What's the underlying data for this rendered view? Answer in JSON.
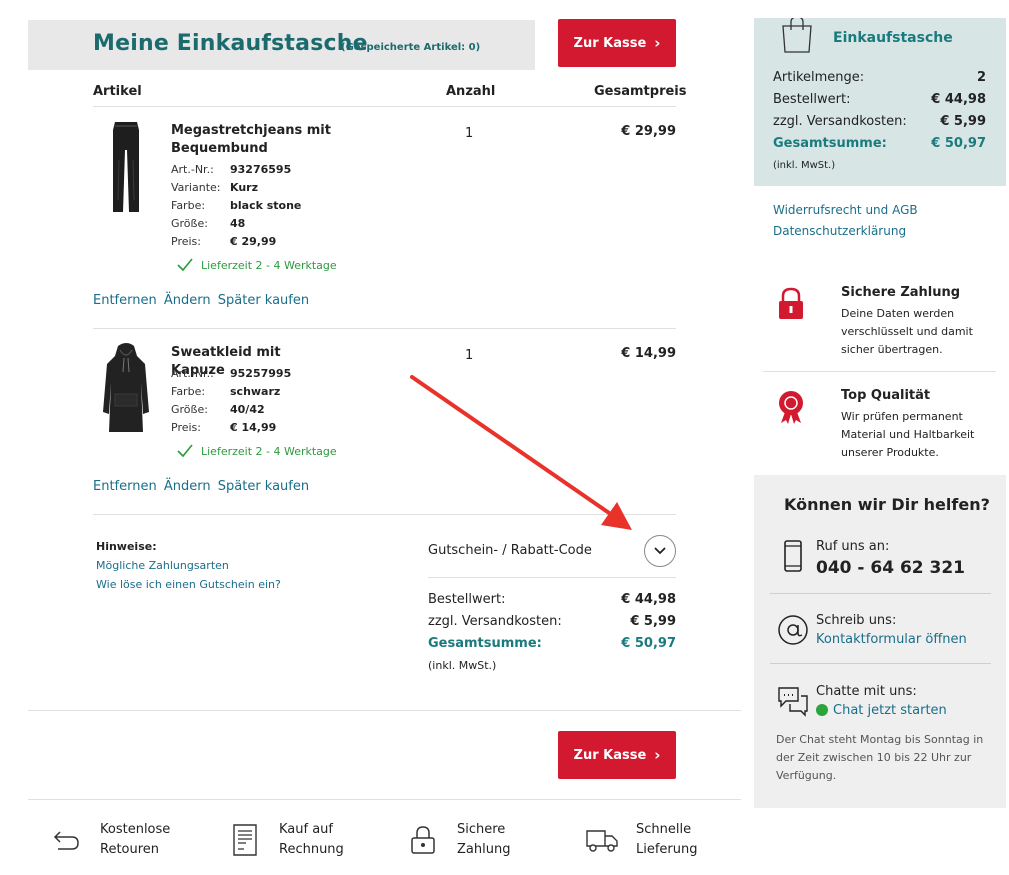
{
  "cart": {
    "title": "Meine Einkaufstasche",
    "saved_label": "(Gespeicherte Artikel: 0)",
    "checkout_label": "Zur Kasse",
    "columns": {
      "article": "Artikel",
      "quantity": "Anzahl",
      "total": "Gesamtpreis"
    }
  },
  "items": [
    {
      "name": "Megastretchjeans mit Bequembund",
      "quantity": "1",
      "price": "€ 29,99",
      "props": [
        {
          "k": "Art.-Nr.:",
          "v": "93276595"
        },
        {
          "k": "Variante:",
          "v": "Kurz"
        },
        {
          "k": "Farbe:",
          "v": "black stone"
        },
        {
          "k": "Größe:",
          "v": "48"
        },
        {
          "k": "Preis:",
          "v": "€ 29,99"
        }
      ],
      "delivery": "Lieferzeit 2 - 4 Werktage",
      "actions": {
        "remove": "Entfernen",
        "edit": "Ändern",
        "later": "Später kaufen"
      }
    },
    {
      "name": "Sweatkleid mit Kapuze",
      "quantity": "1",
      "price": "€ 14,99",
      "props": [
        {
          "k": "Art.-Nr.:",
          "v": "95257995"
        },
        {
          "k": "Farbe:",
          "v": "schwarz"
        },
        {
          "k": "Größe:",
          "v": "40/42"
        },
        {
          "k": "Preis:",
          "v": "€ 14,99"
        }
      ],
      "delivery": "Lieferzeit 2 - 4 Werktage",
      "actions": {
        "remove": "Entfernen",
        "edit": "Ändern",
        "later": "Später kaufen"
      }
    }
  ],
  "hints": {
    "heading": "Hinweise:",
    "payment_link": "Mögliche Zahlungsarten",
    "voucher_link": "Wie löse ich einen Gutschein ein?"
  },
  "coupon": {
    "label": "Gutschein- / Rabatt-Code"
  },
  "summary": {
    "order_value_label": "Bestellwert:",
    "order_value": "€ 44,98",
    "shipping_label": "zzgl. Versandkosten:",
    "shipping": "€ 5,99",
    "total_label": "Gesamtsumme:",
    "total": "€ 50,97",
    "vat_note": "(inkl. MwSt.)"
  },
  "features": [
    {
      "icon": "return-arrow-icon",
      "line1": "Kostenlose",
      "line2": "Retouren"
    },
    {
      "icon": "invoice-icon",
      "line1": "Kauf auf",
      "line2": "Rechnung"
    },
    {
      "icon": "lock-icon",
      "line1": "Sichere",
      "line2": "Zahlung"
    },
    {
      "icon": "truck-icon",
      "line1": "Schnelle",
      "line2": "Lieferung"
    }
  ],
  "sidebar": {
    "bag_title": "Einkaufstasche",
    "item_count_label": "Artikelmenge:",
    "item_count": "2",
    "order_value_label": "Bestellwert:",
    "order_value": "€ 44,98",
    "shipping_label": "zzgl. Versandkosten:",
    "shipping": "€ 5,99",
    "total_label": "Gesamtsumme:",
    "total": "€ 50,97",
    "vat_note": "(inkl. MwSt.)",
    "links": {
      "terms": "Widerrufsrecht und AGB",
      "privacy": "Datenschutzerklärung"
    },
    "trust": [
      {
        "icon": "padlock-icon",
        "title": "Sichere Zahlung",
        "body": "Deine Daten werden verschlüsselt und damit sicher übertragen."
      },
      {
        "icon": "quality-seal-icon",
        "title": "Top Qualität",
        "body": "Wir prüfen permanent Material und Haltbarkeit unserer Produkte."
      }
    ]
  },
  "help": {
    "title": "Können wir Dir helfen?",
    "call_label": "Ruf uns an:",
    "phone": "040 - 64 62 321",
    "write_label": "Schreib uns:",
    "contact_link": "Kontaktformular öffnen",
    "chat_label": "Chatte mit uns:",
    "chat_link": "Chat jetzt starten",
    "chat_note": "Der Chat steht Montag bis Sonntag in der Zeit zwischen 10 bis 22 Uhr zur Verfügung."
  },
  "colors": {
    "accent_red": "#d3192f",
    "teal": "#1b6a6e",
    "link": "#1a6e8a",
    "annotation_arrow": "#e8322a",
    "delivery_green": "#2d9a3e"
  }
}
